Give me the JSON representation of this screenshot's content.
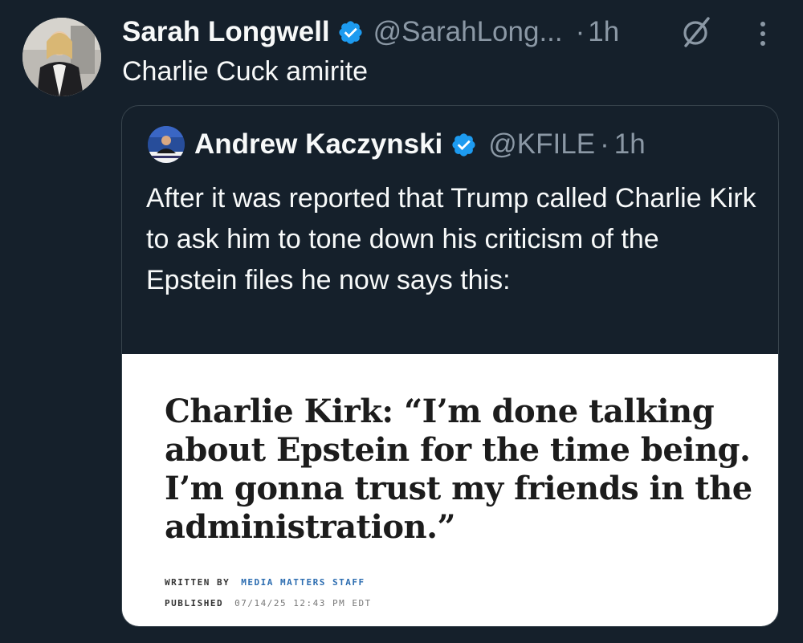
{
  "tweet": {
    "author_name": "Sarah Longwell",
    "handle": "@SarahLong...",
    "dot": "·",
    "time_ago": "1h",
    "text": "Charlie Cuck amirite"
  },
  "quoted_tweet": {
    "author_name": "Andrew Kaczynski",
    "handle": "@KFILE",
    "dot": "·",
    "time_ago": "1h",
    "text": "After it was reported that Trump called Charlie Kirk to ask him to tone down his criticism of the Epstein files he now says this:",
    "media": {
      "headline": "Charlie Kirk: “I’m done talking about Epstein for the time being. I’m gonna trust my friends in the administration.”",
      "written_by_label": "WRITTEN BY",
      "written_by_value": "MEDIA MATTERS STAFF",
      "published_label": "PUBLISHED",
      "published_value": "07/14/25 12:43 PM EDT"
    }
  },
  "icons": {
    "verified": "verified-badge-icon",
    "grok": "grok-icon",
    "more": "more-options-icon"
  },
  "colors": {
    "background": "#15202b",
    "primary_text": "#f7f9f9",
    "secondary_text": "#8b98a5",
    "verified_blue": "#1d9bf0",
    "card_border": "#38444d",
    "link_blue": "#2b6cb0"
  }
}
